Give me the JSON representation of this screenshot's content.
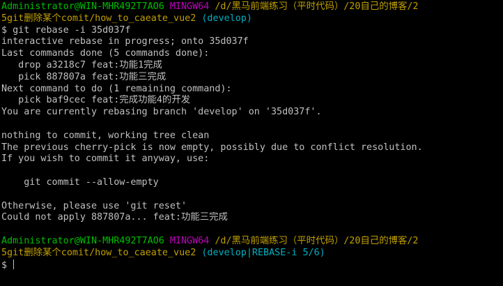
{
  "prompt1": {
    "user_host": "Administrator@WIN-MHR492T7AO6",
    "shell": "MINGW64",
    "path_part1": "/d/黑马前端练习（平时代码）/20自己的博客/2",
    "path_part2": "5git删除某个comit/how_to_caeate_vue2",
    "branch": "(develop)"
  },
  "command": "$ git rebase -i 35d037f",
  "output": [
    "interactive rebase in progress; onto 35d037f",
    "Last commands done (5 commands done):",
    "   drop a3218c7 feat:功能1完成",
    "   pick 887807a feat:功能三完成",
    "Next command to do (1 remaining command):",
    "   pick baf9cec feat:完成功能4的开发",
    "You are currently rebasing branch 'develop' on '35d037f'.",
    "",
    "nothing to commit, working tree clean",
    "The previous cherry-pick is now empty, possibly due to conflict resolution.",
    "If you wish to commit it anyway, use:",
    "",
    "    git commit --allow-empty",
    "",
    "Otherwise, please use 'git reset'",
    "Could not apply 887807a... feat:功能三完成",
    ""
  ],
  "prompt2": {
    "user_host": "Administrator@WIN-MHR492T7AO6",
    "shell": "MINGW64",
    "path_part1": "/d/黑马前端练习（平时代码）/20自己的博客/2",
    "path_part2": "5git删除某个comit/how_to_caeate_vue2",
    "branch": "(develop|REBASE-i 5/6)"
  },
  "input_prompt": "$ "
}
